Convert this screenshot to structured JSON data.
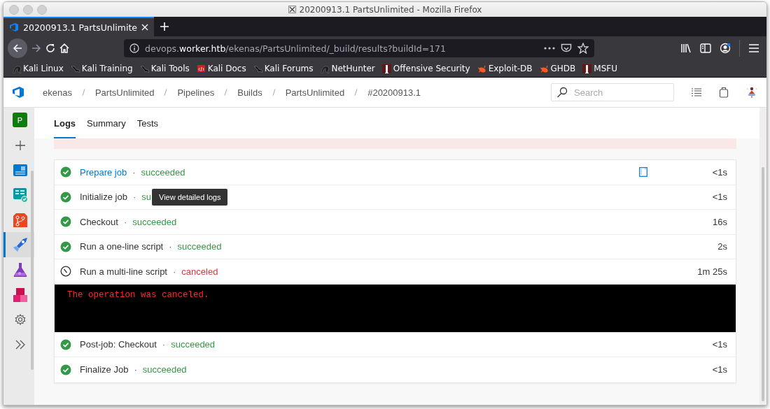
{
  "window": {
    "title": "20200913.1 PartsUnlimited - Mozilla Firefox"
  },
  "browser_tabs": [
    {
      "label": "20200913.1 PartsUnlimite",
      "selected": true
    }
  ],
  "address_bar": {
    "url": "devops.**worker.htb**/ekenas/PartsUnlimited/_build/results?buildId=171"
  },
  "bookmarks": [
    {
      "label": "Kali Linux",
      "kind": "dragon"
    },
    {
      "label": "Kali Training",
      "kind": "kali"
    },
    {
      "label": "Kali Tools",
      "kind": "kali"
    },
    {
      "label": "Kali Docs",
      "kind": "docs"
    },
    {
      "label": "Kali Forums",
      "kind": "kali"
    },
    {
      "label": "NetHunter",
      "kind": "dragon"
    },
    {
      "label": "Offensive Security",
      "kind": "offsec"
    },
    {
      "label": "Exploit-DB",
      "kind": "bug"
    },
    {
      "label": "GHDB",
      "kind": "bug"
    },
    {
      "label": "MSFU",
      "kind": "offsec"
    }
  ],
  "breadcrumbs": [
    "ekenas",
    "PartsUnlimited",
    "Pipelines",
    "Builds",
    "PartsUnlimited",
    "#20200913.1"
  ],
  "search": {
    "placeholder": "Search"
  },
  "sidebar": {
    "items": [
      {
        "kind": "project",
        "label": "P",
        "selected": false
      },
      {
        "kind": "add",
        "selected": false
      },
      {
        "kind": "overview",
        "selected": false
      },
      {
        "kind": "boards",
        "selected": false
      },
      {
        "kind": "repos",
        "selected": false
      },
      {
        "kind": "pipelines",
        "selected": true
      },
      {
        "kind": "testplans",
        "selected": false
      },
      {
        "kind": "artifacts",
        "selected": false
      },
      {
        "kind": "settings",
        "selected": false
      },
      {
        "kind": "expand",
        "selected": false
      }
    ]
  },
  "tabs": [
    {
      "label": "Logs",
      "selected": true
    },
    {
      "label": "Summary",
      "selected": false
    },
    {
      "label": "Tests",
      "selected": false
    }
  ],
  "steps": [
    {
      "name": "Prepare job",
      "separator": "·",
      "status": "succeeded",
      "kind": "succeeded",
      "duration": "<1s",
      "hovered": true
    },
    {
      "name": "Initialize job",
      "separator": "·",
      "status": "su",
      "kind": "succeeded",
      "duration": "<1s",
      "hovered": false,
      "tooltip": "View detailed logs"
    },
    {
      "name": "Checkout",
      "separator": "·",
      "status": "succeeded",
      "kind": "succeeded",
      "duration": "16s",
      "hovered": false
    },
    {
      "name": "Run a one-line script",
      "separator": "·",
      "status": "succeeded",
      "kind": "succeeded",
      "duration": "2s",
      "hovered": false
    },
    {
      "name": "Run a multi-line script",
      "separator": "·",
      "status": "canceled",
      "kind": "canceled",
      "duration": "1m 25s",
      "hovered": false,
      "log": [
        "The operation was canceled."
      ]
    },
    {
      "name": "Post-job: Checkout",
      "separator": "·",
      "status": "succeeded",
      "kind": "succeeded",
      "duration": "<1s",
      "hovered": false
    },
    {
      "name": "Finalize Job",
      "separator": "·",
      "status": "succeeded",
      "kind": "succeeded",
      "duration": "<1s",
      "hovered": false
    }
  ]
}
